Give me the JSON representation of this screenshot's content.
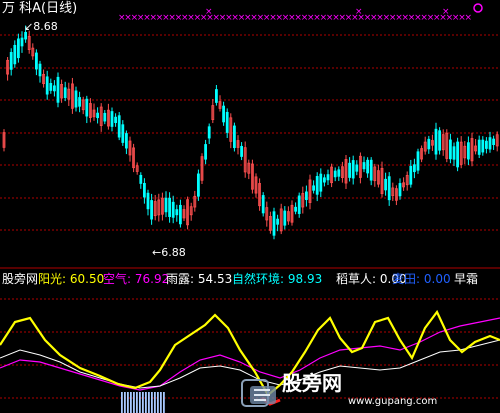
{
  "title": "万 科A(日线)",
  "price_high_label": "8.68",
  "price_low_label": "6.88",
  "indicator_bar": {
    "name": "股旁网",
    "items": [
      {
        "label": "阳光:",
        "value": "60.50",
        "label_color": "#ffff00",
        "value_color": "#ffff00"
      },
      {
        "label": "空气:",
        "value": "76.92",
        "label_color": "#ff00ff",
        "value_color": "#ff00ff"
      },
      {
        "label": "雨露:",
        "value": "54.53",
        "label_color": "#ffffff",
        "value_color": "#ffffff"
      },
      {
        "label": "自然环境:",
        "value": "98.93",
        "label_color": "#00ffff",
        "value_color": "#00ffff"
      },
      {
        "label": "稻草人:",
        "value": "0.00",
        "label_color": "#ffffff",
        "value_color": "#ffffff"
      },
      {
        "label": "麦田:",
        "value": "0.00",
        "label_color": "#2060ff",
        "value_color": "#2060ff"
      },
      {
        "label": "早霜",
        "value": "",
        "label_color": "#ffffff",
        "value_color": "#ffffff"
      }
    ]
  },
  "watermark": "股旁网",
  "watermark_url": "www.gupang.com",
  "colors": {
    "up": "#ff5050",
    "down": "#00ffff",
    "grid": "#b00000",
    "sunshine": "#ffff00",
    "air": "#ff00ff",
    "dew": "#ffffff"
  }
}
